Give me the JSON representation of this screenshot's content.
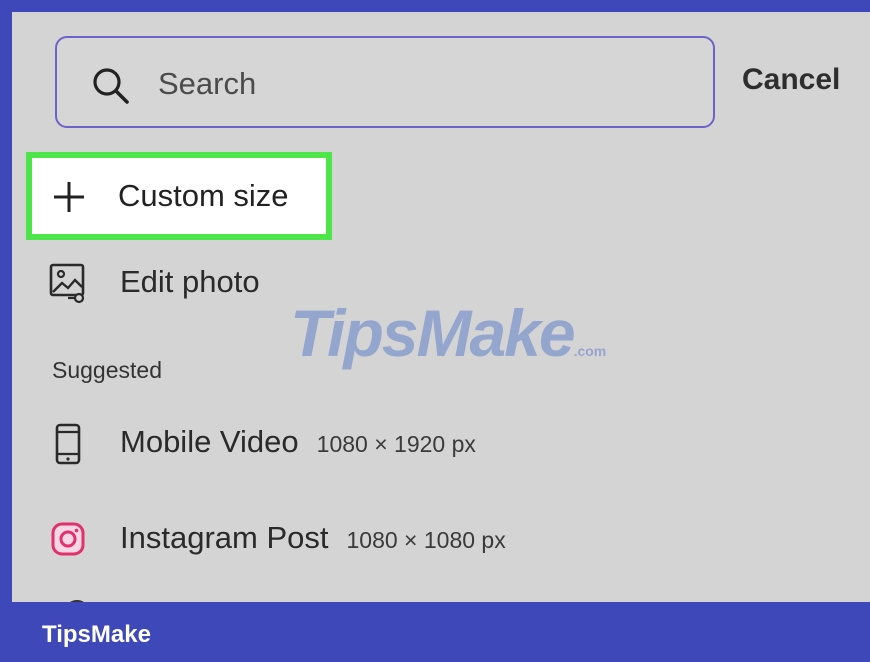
{
  "search": {
    "placeholder": "Search",
    "cancel_label": "Cancel",
    "icon": "search-icon"
  },
  "actions": {
    "custom_size_label": "Custom size",
    "custom_size_icon": "plus-icon",
    "edit_photo_label": "Edit photo",
    "edit_photo_icon": "image-edit-icon"
  },
  "suggested": {
    "heading": "Suggested",
    "items": [
      {
        "label": "Mobile Video",
        "dims": "1080 × 1920 px",
        "icon": "phone-icon"
      },
      {
        "label": "Instagram Post",
        "dims": "1080 × 1080 px",
        "icon": "instagram-icon"
      }
    ]
  },
  "watermark": {
    "text": "TipsMake",
    "suffix": ".com"
  },
  "footer": {
    "brand": "TipsMake"
  },
  "colors": {
    "frame": "#3e48b8",
    "panel": "#d4d4d4",
    "highlight": "#4ee54a",
    "search_border": "#6c63c9",
    "instagram": "#e1306c"
  }
}
